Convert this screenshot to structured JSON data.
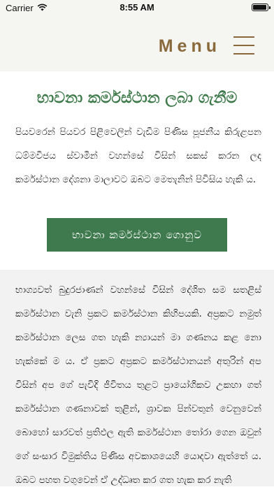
{
  "status_bar": {
    "carrier": "Carrier",
    "time": "8:55 AM",
    "battery_level": 1.0,
    "icons": [
      "wifi-icon",
      "battery-icon"
    ]
  },
  "header": {
    "menu_label": "Menu",
    "menu_icon": "hamburger-icon",
    "accent_color": "#8a6a3c"
  },
  "main": {
    "title": "භාවනා කර්මස්ථාන ලබා ගැනීම",
    "title_color": "#3e7a4a",
    "intro": "පියවරෙන් පියවර පිළිවෙලින් වැඩීම පිණිස පූජනීය කිරුළපන ධම්මවිජය ස්වාමීන් වහන්සේ විසින් සකස් කරන ලද කර්මස්ථාන දේශනා මාලාවට ඔබට මෙතැනින් පිවිසිය හැකි ය.",
    "button_label": "භාවනා කර්මස්ථාන ගොනුව",
    "button_color": "#3f7a4e"
  },
  "article": {
    "text": "භාග්‍යවත් බුදුරජාණන් වහන්සේ විසින් දේශිත සම සතළිස් කර්මස්ථාන වැනි ප්‍රකට කර්මස්ථාන කිහිපයකි. අප්‍රකට නමුත් කර්මස්ථාන ලෙස ගත හැකි න්‍යායන් මා ගණනය කළ නො හැක්කේ ම ය. ඒ ප්‍රකට අප්‍රකට කර්මස්ථානයන් අතුරින් අප විසින් අප ගේ පැවිදි ජීවිතය තුළට ප්‍රායෝගිකව උකහා ගත් කර්මස්ථාන ගණනාවක් තුළින්, ශ්‍රාවක පින්වතුන් වෙනුවෙන් බොහෝ සාරවත් ප්‍රතිඵල ඇති කර්මස්ථාන තෝරා ගෙන ඔවුන් ගේ සංසාර විමුක්තිය පිණිස අවකාශයෙහි යොදවා ඇත්තේ ය. ඔබට පහත වගුවෙන් ඒ උද්ධෘත කර ගත හැක කර නැති"
  }
}
